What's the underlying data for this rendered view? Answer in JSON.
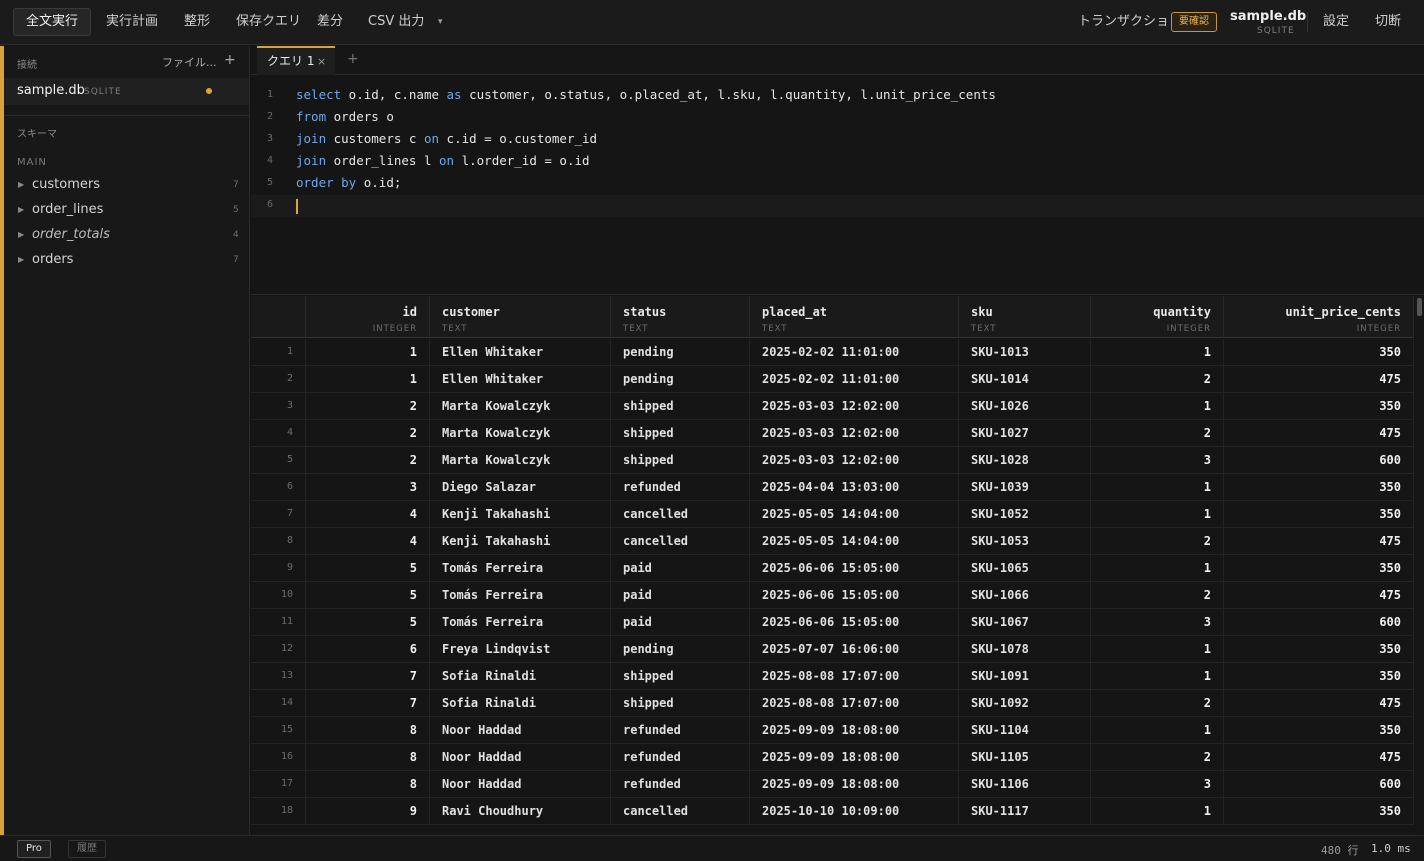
{
  "toolbar": {
    "run_all": "全文実行",
    "explain": "実行計画",
    "format": "整形",
    "save_query": "保存クエリ",
    "diff": "差分",
    "csv_export": "CSV 出力",
    "more": "▾",
    "transaction": "トランザクション",
    "confirm_badge": "要確認",
    "db_name": "sample.db",
    "db_engine": "SQLITE",
    "settings": "設定",
    "disconnect": "切断"
  },
  "sidebar": {
    "connections_label": "接続",
    "file_button": "ファイル...",
    "add": "+",
    "connection": {
      "name": "sample.db",
      "engine": "SQLITE"
    },
    "schema_label": "スキーマ",
    "schema_name": "MAIN",
    "items": [
      {
        "name": "customers",
        "count": "7"
      },
      {
        "name": "order_lines",
        "count": "5"
      },
      {
        "name": "order_totals",
        "count": "4"
      },
      {
        "name": "orders",
        "count": "7"
      }
    ]
  },
  "tabs": [
    {
      "label": "クエリ 1",
      "close": "×"
    }
  ],
  "tab_add": "+",
  "editor": {
    "line_numbers": [
      "1",
      "2",
      "3",
      "4",
      "5",
      "6"
    ]
  },
  "grid": {
    "columns": [
      {
        "name": "id",
        "type": "INTEGER"
      },
      {
        "name": "customer",
        "type": "TEXT"
      },
      {
        "name": "status",
        "type": "TEXT"
      },
      {
        "name": "placed_at",
        "type": "TEXT"
      },
      {
        "name": "sku",
        "type": "TEXT"
      },
      {
        "name": "quantity",
        "type": "INTEGER"
      },
      {
        "name": "unit_price_cents",
        "type": "INTEGER"
      }
    ],
    "rows": [
      [
        "1",
        "1",
        "Ellen Whitaker",
        "pending",
        "2025-02-02 11:01:00",
        "SKU-1013",
        "1",
        "350"
      ],
      [
        "2",
        "1",
        "Ellen Whitaker",
        "pending",
        "2025-02-02 11:01:00",
        "SKU-1014",
        "2",
        "475"
      ],
      [
        "3",
        "2",
        "Marta Kowalczyk",
        "shipped",
        "2025-03-03 12:02:00",
        "SKU-1026",
        "1",
        "350"
      ],
      [
        "4",
        "2",
        "Marta Kowalczyk",
        "shipped",
        "2025-03-03 12:02:00",
        "SKU-1027",
        "2",
        "475"
      ],
      [
        "5",
        "2",
        "Marta Kowalczyk",
        "shipped",
        "2025-03-03 12:02:00",
        "SKU-1028",
        "3",
        "600"
      ],
      [
        "6",
        "3",
        "Diego Salazar",
        "refunded",
        "2025-04-04 13:03:00",
        "SKU-1039",
        "1",
        "350"
      ],
      [
        "7",
        "4",
        "Kenji Takahashi",
        "cancelled",
        "2025-05-05 14:04:00",
        "SKU-1052",
        "1",
        "350"
      ],
      [
        "8",
        "4",
        "Kenji Takahashi",
        "cancelled",
        "2025-05-05 14:04:00",
        "SKU-1053",
        "2",
        "475"
      ],
      [
        "9",
        "5",
        "Tomás Ferreira",
        "paid",
        "2025-06-06 15:05:00",
        "SKU-1065",
        "1",
        "350"
      ],
      [
        "10",
        "5",
        "Tomás Ferreira",
        "paid",
        "2025-06-06 15:05:00",
        "SKU-1066",
        "2",
        "475"
      ],
      [
        "11",
        "5",
        "Tomás Ferreira",
        "paid",
        "2025-06-06 15:05:00",
        "SKU-1067",
        "3",
        "600"
      ],
      [
        "12",
        "6",
        "Freya Lindqvist",
        "pending",
        "2025-07-07 16:06:00",
        "SKU-1078",
        "1",
        "350"
      ],
      [
        "13",
        "7",
        "Sofia Rinaldi",
        "shipped",
        "2025-08-08 17:07:00",
        "SKU-1091",
        "1",
        "350"
      ],
      [
        "14",
        "7",
        "Sofia Rinaldi",
        "shipped",
        "2025-08-08 17:07:00",
        "SKU-1092",
        "2",
        "475"
      ],
      [
        "15",
        "8",
        "Noor Haddad",
        "refunded",
        "2025-09-09 18:08:00",
        "SKU-1104",
        "1",
        "350"
      ],
      [
        "16",
        "8",
        "Noor Haddad",
        "refunded",
        "2025-09-09 18:08:00",
        "SKU-1105",
        "2",
        "475"
      ],
      [
        "17",
        "8",
        "Noor Haddad",
        "refunded",
        "2025-09-09 18:08:00",
        "SKU-1106",
        "3",
        "600"
      ],
      [
        "18",
        "9",
        "Ravi Choudhury",
        "cancelled",
        "2025-10-10 10:09:00",
        "SKU-1117",
        "1",
        "350"
      ]
    ]
  },
  "statusbar": {
    "pro": "Pro",
    "history": "履歴",
    "row_count": "480 行",
    "timing": "1.0 ms"
  },
  "colors": {
    "accent": "#d9a23a",
    "keyword": "#6ea8e8",
    "background": "#141414"
  }
}
